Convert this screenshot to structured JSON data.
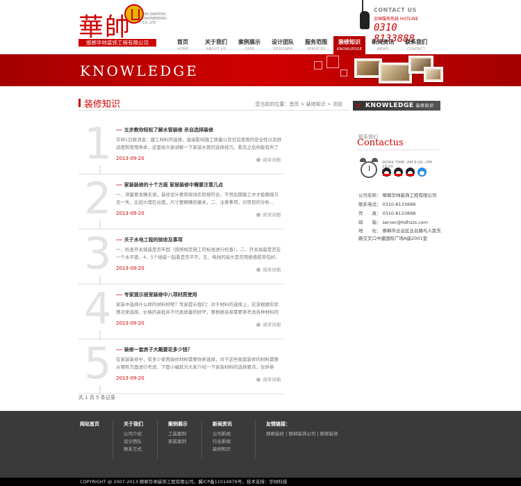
{
  "logo": {
    "cn": "華帥",
    "en": "DECORATION ENGINEERING CO.,LTD",
    "bar": "邯郸华帅装饰工程有限公司"
  },
  "contact": {
    "title": "CONTACT US",
    "sub": "全国服务热线 HOTLINE",
    "number": "0310 8133888"
  },
  "nav": [
    {
      "cn": "首页",
      "en": "HOME"
    },
    {
      "cn": "关于我们",
      "en": "ABOUT US"
    },
    {
      "cn": "案例展示",
      "en": "CASE"
    },
    {
      "cn": "设计团队",
      "en": "DESIGNER"
    },
    {
      "cn": "服务范围",
      "en": "SERVICES"
    },
    {
      "cn": "装修知识",
      "en": "KNOWLEDGE"
    },
    {
      "cn": "新闻资讯",
      "en": "NEWS"
    },
    {
      "cn": "联系我们",
      "en": "CONTACT"
    }
  ],
  "banner": {
    "title": "KNOWLEDGE"
  },
  "page": {
    "title": "装修知识",
    "breadcrumb": "您当前的位置：首页 > 装修知识 > 浏览"
  },
  "articles": [
    {
      "num": "1",
      "title": "五步教你轻松了解水管装修 杀自选择装修",
      "desc": "华帅1日新消息：建工材料的选择，直接影响施工质量以及日后使用的安全性以及舒适度和使用寿命，这里给大家讲解一下家装水管的选择技巧，看完之后你能有所了解...",
      "date": "2013-09-20",
      "more": "阅读详细"
    },
    {
      "num": "2",
      "title": "家装装修的十个方面 家居装修中需要注意几点",
      "desc": "一、测量要准确无误，装修设计要和现场实际相符合，不然后期施工中才能确保万无一失，比如大理石台面，尺寸要精确到毫米，二、注意事项，对项目的分析...",
      "date": "2013-09-20",
      "more": "阅读详细"
    },
    {
      "num": "3",
      "title": "关于水电工程的验收及事项",
      "desc": "一、检查开关插座是否牢固（按照规定施工的标准进行检查），二、开关插座是否在一个水平面，4、5个插座一起看是否平齐，五、电线的接头是否用绝缘胶带包好，管路是否畅通...",
      "date": "2013-09-20",
      "more": "阅读详细"
    },
    {
      "num": "4",
      "title": "专家提示居室装修中八项材质使用",
      "desc": "家装中选择什么样的材料好呢？专家提示我们：对于材料的选择上，应该根据实际情况来选择，价格的高低并不代表质量的好坏，要根据自身需要来考虑各种材料的特点...",
      "date": "2013-09-20",
      "more": "阅读详细"
    },
    {
      "num": "5",
      "title": "装修一套房子大概要花多少钱？",
      "desc": "在家装装修中，有多少家用装修材料需要你来选择，对于这些家庭装修的材料需要从哪些方面进行考虑，下面小编就为大家介绍一下家装材料的选择要点，仅供参考...",
      "date": "2013-09-20",
      "more": "阅读详细"
    }
  ],
  "paging": "共 1 页 5 条记录",
  "sidebar": {
    "knowledge_header": "KNOWLEDGE",
    "knowledge_small": "装修知识",
    "contact_cn": "联系我们",
    "contact_en": "Contactus",
    "work_time": "WORK TIME: AM 8:00—PM 18:00",
    "info": [
      {
        "k": "公司名称：",
        "v": "邯郸华帅装饰工程有限公司"
      },
      {
        "k": "联系电话：",
        "v": "0310-8133888"
      },
      {
        "k": "传　　真：",
        "v": "0310-8133888"
      },
      {
        "k": "邮　　箱：",
        "v": "server@hdhszs.com"
      },
      {
        "k": "地　　址：",
        "v": "邯郸市丛台区丛台路与人民东路交叉口中建国际广场A座2001室"
      }
    ]
  },
  "footer": {
    "columns": [
      {
        "h": "网站首页",
        "links": []
      },
      {
        "h": "关于我们",
        "links": [
          "公司介绍",
          "设计团队",
          "联系方式"
        ]
      },
      {
        "h": "案例展示",
        "links": [
          "工装案例",
          "家装案例"
        ]
      },
      {
        "h": "新闻资讯",
        "links": [
          "公司新闻",
          "行业新闻",
          "装修知识"
        ]
      },
      {
        "h": "友情链接：",
        "links": [
          "邯郸装修 | 邯郸装饰公司 | 邯郸装修"
        ]
      }
    ],
    "copyright": "COPYRIGHT @ 2007-2013 邯郸华帅装饰工程有限公司，冀ICP备11014979号，技术支持：华帅科技"
  },
  "colors": {
    "accent": "#c40000",
    "footer_bg": "#3a3a3a"
  }
}
